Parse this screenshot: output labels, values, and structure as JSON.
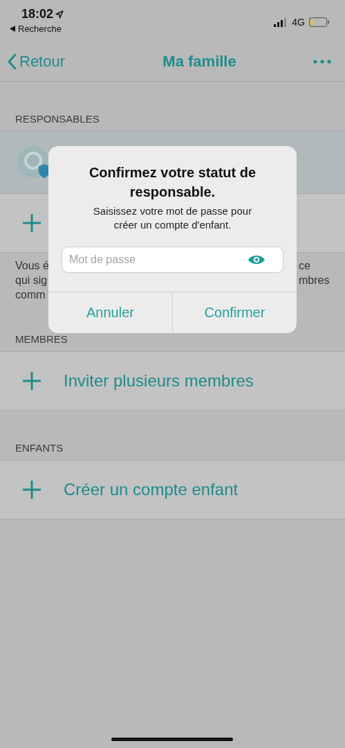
{
  "status_bar": {
    "time": "18:02",
    "back_app": "Recherche",
    "network": "4G"
  },
  "nav": {
    "back": "Retour",
    "title": "Ma famille"
  },
  "sections": [
    {
      "header": "RESPONSABLES",
      "rows": [
        {
          "kind": "member"
        },
        {
          "kind": "add"
        }
      ],
      "footer_left": [
        "Vous é",
        "qui sig",
        "comm"
      ],
      "footer_right": [
        "ce",
        "mbres"
      ]
    },
    {
      "header": "MEMBRES",
      "rows": [
        {
          "kind": "add",
          "label": "Inviter plusieurs membres"
        }
      ]
    },
    {
      "header": "ENFANTS",
      "rows": [
        {
          "kind": "add",
          "label": "Créer un compte enfant"
        }
      ]
    }
  ],
  "dialog": {
    "title": "Confirmez votre statut de responsable.",
    "message": "Saisissez votre mot de passe pour créer un compte d'enfant.",
    "field": {
      "placeholder": "Mot de passe"
    },
    "buttons": [
      "Annuler",
      "Confirmer"
    ]
  }
}
